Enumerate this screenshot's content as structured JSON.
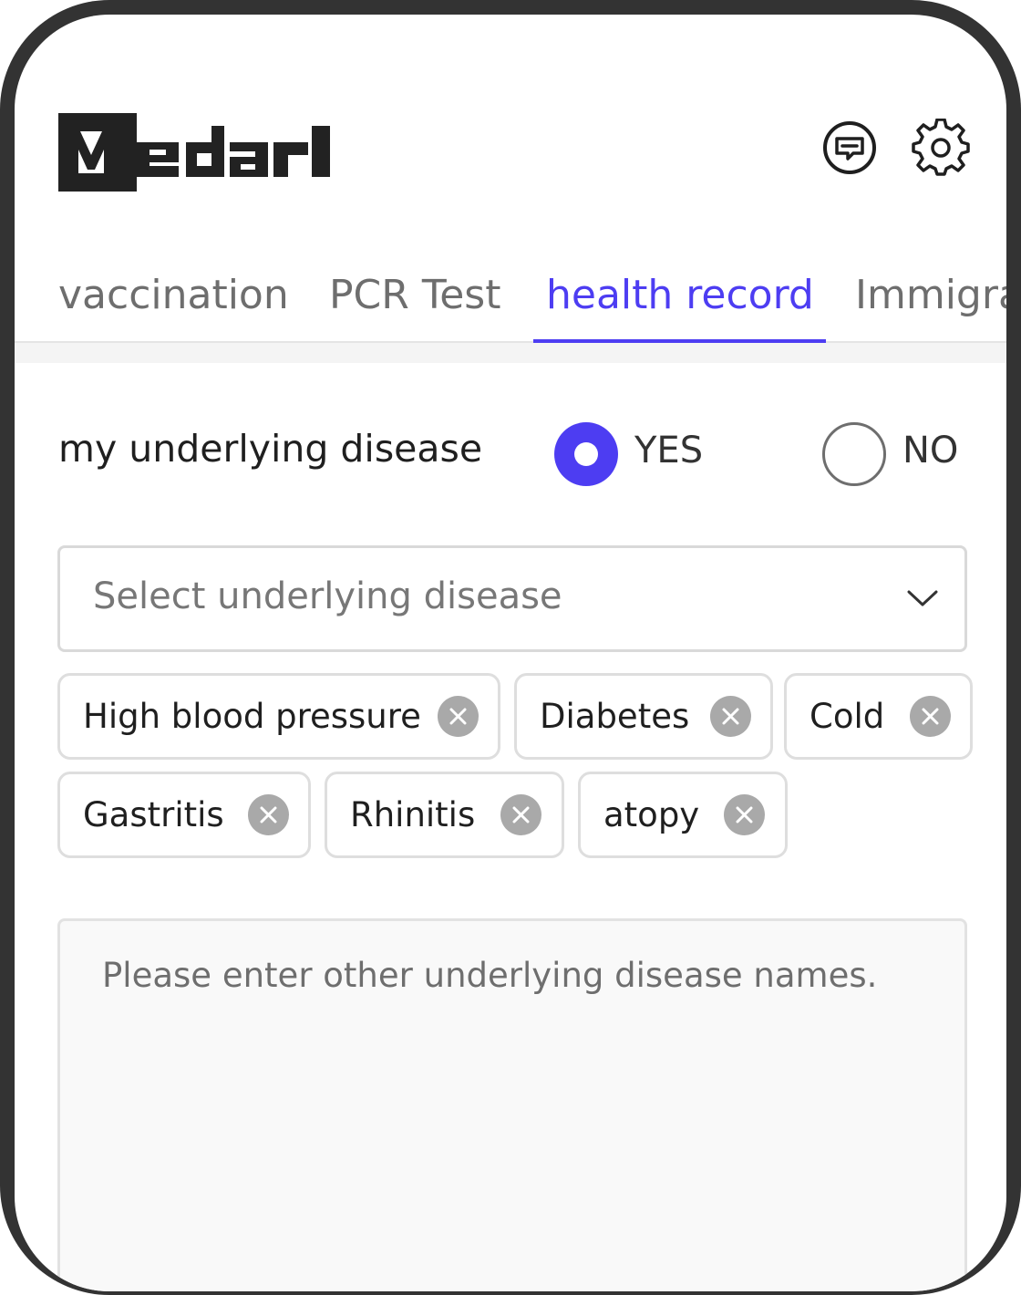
{
  "header": {
    "logo_text": "Medarl"
  },
  "tabs": [
    {
      "label": "vaccination"
    },
    {
      "label": "PCR Test"
    },
    {
      "label": "health record"
    },
    {
      "label": "Immigra"
    }
  ],
  "active_tab": "health record",
  "underlying_disease": {
    "question": "my underlying disease",
    "yes_label": "YES",
    "no_label": "NO",
    "selected": "YES"
  },
  "select": {
    "placeholder": "Select underlying disease"
  },
  "chips": [
    {
      "label": "High blood pressure"
    },
    {
      "label": "Diabetes"
    },
    {
      "label": "Cold"
    },
    {
      "label": "Gastritis"
    },
    {
      "label": "Rhinitis"
    },
    {
      "label": "atopy"
    }
  ],
  "other_input": {
    "placeholder": "Please enter other underlying disease names."
  },
  "colors": {
    "accent": "#4d3df2",
    "frame": "#333333",
    "chip_remove": "#a9a9a9"
  },
  "icons": [
    "chat-icon",
    "gear-icon",
    "chevron-down-icon",
    "close-icon"
  ]
}
